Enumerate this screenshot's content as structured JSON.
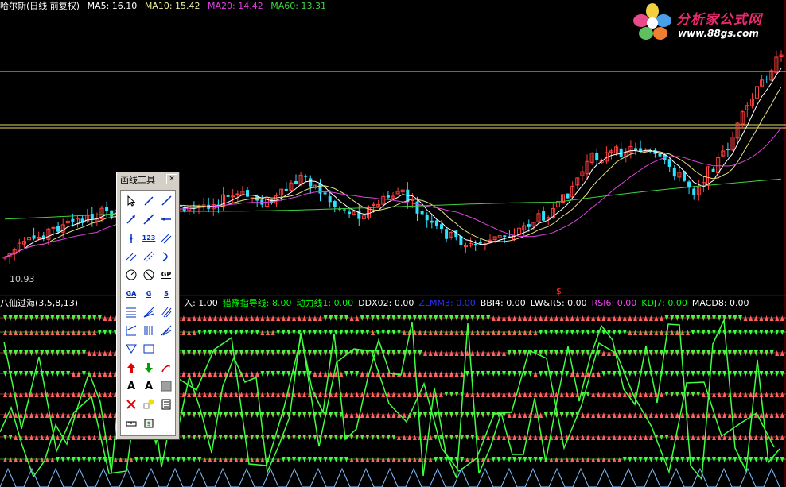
{
  "header": {
    "title": "哈尔斯(日线 前复权)",
    "ma5": "MA5: 16.10",
    "ma10": "MA10: 15.42",
    "ma20": "MA20: 14.42",
    "ma60": "MA60: 13.31"
  },
  "logo": {
    "name": "分析家公式网",
    "url": "www.88gs.com"
  },
  "price_low_label": "10.93",
  "signal_marker": "$",
  "indicator_bar": {
    "name": "八仙过海(3,5,8,13)",
    "items": [
      {
        "text": "入: 1.00",
        "color": "#ffffff"
      },
      {
        "text": "猎豫指导线: 8.00",
        "color": "#00ff00"
      },
      {
        "text": "动力线1: 0.00",
        "color": "#00ff00"
      },
      {
        "text": "DDX02: 0.00",
        "color": "#ffffff"
      },
      {
        "text": "ZLMM3: 0.00",
        "color": "#3030ff"
      },
      {
        "text": "BBI4: 0.00",
        "color": "#ffffff"
      },
      {
        "text": "LW&R5: 0.00",
        "color": "#ffffff"
      },
      {
        "text": "RSI6: 0.00",
        "color": "#ff40ff"
      },
      {
        "text": "KDJ7: 0.00",
        "color": "#00ff00"
      },
      {
        "text": "MACD8: 0.00",
        "color": "#ffffff"
      }
    ]
  },
  "toolbox": {
    "title": "画线工具",
    "close": "×",
    "tools": [
      "pointer-icon",
      "line-segment-icon",
      "ray-icon",
      "arrow-line-icon",
      "extended-line-icon",
      "horizontal-ray-icon",
      "vertical-line-icon",
      "price-label-icon",
      "parallel-channel-icon",
      "parallel-lines-icon",
      "linear-regression-icon",
      "arc-icon",
      "circle-icon",
      "no-entry-icon",
      "gp-icon",
      "gann-angle-icon",
      "gann-fan-icon",
      "fibonacci-icon",
      "trend-channel-icon",
      "speed-lines-icon",
      "gann-grid-icon",
      "fib-time-zones-icon",
      "cycle-lines-icon",
      "fib-fan-icon",
      "triangle-icon",
      "rectangle-icon",
      "empty-slot",
      "up-arrow-icon",
      "down-arrow-icon",
      "curved-arrow-icon",
      "text-icon",
      "text-alt-icon",
      "gray-box-icon",
      "delete-icon",
      "color-picker-icon",
      "list-icon",
      "ruler-icon",
      "dollar-tool-icon",
      "empty-slot"
    ],
    "labels": {
      "price_label": "123",
      "gp": "GP",
      "ga": "GA",
      "g": "G",
      "s": "S",
      "text": "A",
      "text_alt": "A"
    }
  },
  "colors": {
    "up": "#ff4040",
    "down": "#30e0ff",
    "ma5": "#ffffff",
    "ma10": "#e8e080",
    "ma20": "#e040e0",
    "ma60": "#40d040",
    "signal_green": "#40ff40",
    "signal_red": "#ff6060",
    "guide_yellow": "#e8d860"
  }
}
